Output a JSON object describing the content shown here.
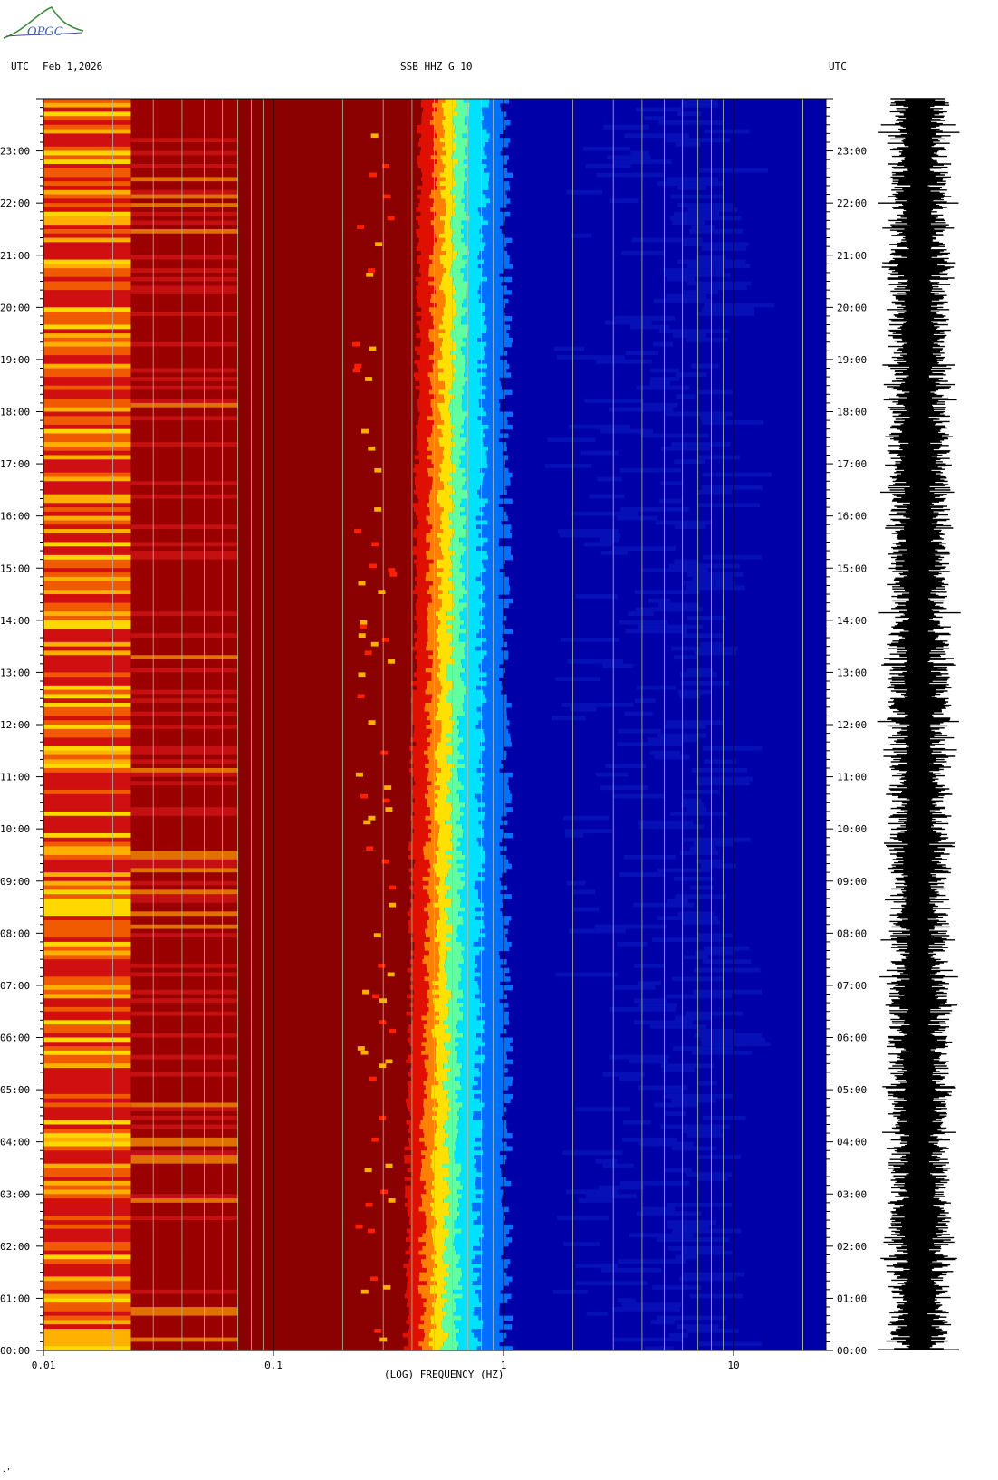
{
  "header": {
    "left_tz": "UTC",
    "date": "Feb 1,2026",
    "station": "SSB HHZ G 10",
    "right_tz": "UTC"
  },
  "logo": {
    "text": "OPGC",
    "icon": "opgc-logo"
  },
  "footer_mark": "·’",
  "chart_data": {
    "type": "heatmap",
    "title": "SSB HHZ G 10",
    "xlabel": "(LOG) FREQUENCY (HZ)",
    "ylabel": "UTC",
    "x_scale": "log",
    "xlim": [
      0.01,
      25
    ],
    "x_ticks": [
      {
        "value": 0.01,
        "label": "0.01"
      },
      {
        "value": 0.1,
        "label": "0.1"
      },
      {
        "value": 1,
        "label": "1"
      },
      {
        "value": 10,
        "label": "10"
      }
    ],
    "ylim_hours": [
      0,
      24
    ],
    "y_ticks": [
      "00:00",
      "01:00",
      "02:00",
      "03:00",
      "04:00",
      "05:00",
      "06:00",
      "07:00",
      "08:00",
      "09:00",
      "10:00",
      "11:00",
      "12:00",
      "13:00",
      "14:00",
      "15:00",
      "16:00",
      "17:00",
      "18:00",
      "19:00",
      "20:00",
      "21:00",
      "22:00",
      "23:00"
    ],
    "colormap": [
      "#00008b",
      "#0000ff",
      "#00bfff",
      "#00ffff",
      "#7fff7f",
      "#ffff00",
      "#ff7f00",
      "#ff0000",
      "#8b0000"
    ],
    "bands": [
      {
        "from_hz": 0.01,
        "to_hz": 0.024,
        "level": "high, variable (red-orange-yellow)"
      },
      {
        "from_hz": 0.024,
        "to_hz": 0.07,
        "level": "high (dark red with lines)"
      },
      {
        "from_hz": 0.07,
        "to_hz": 0.3,
        "level": "saturated (dark red)"
      },
      {
        "from_hz": 0.3,
        "to_hz": 0.7,
        "level": "microseism peak transition (red-yellow-cyan)"
      },
      {
        "from_hz": 0.7,
        "to_hz": 25,
        "level": "low (blue)"
      }
    ],
    "waveform": {
      "label": "trace",
      "color": "#000000"
    },
    "grid": true
  }
}
